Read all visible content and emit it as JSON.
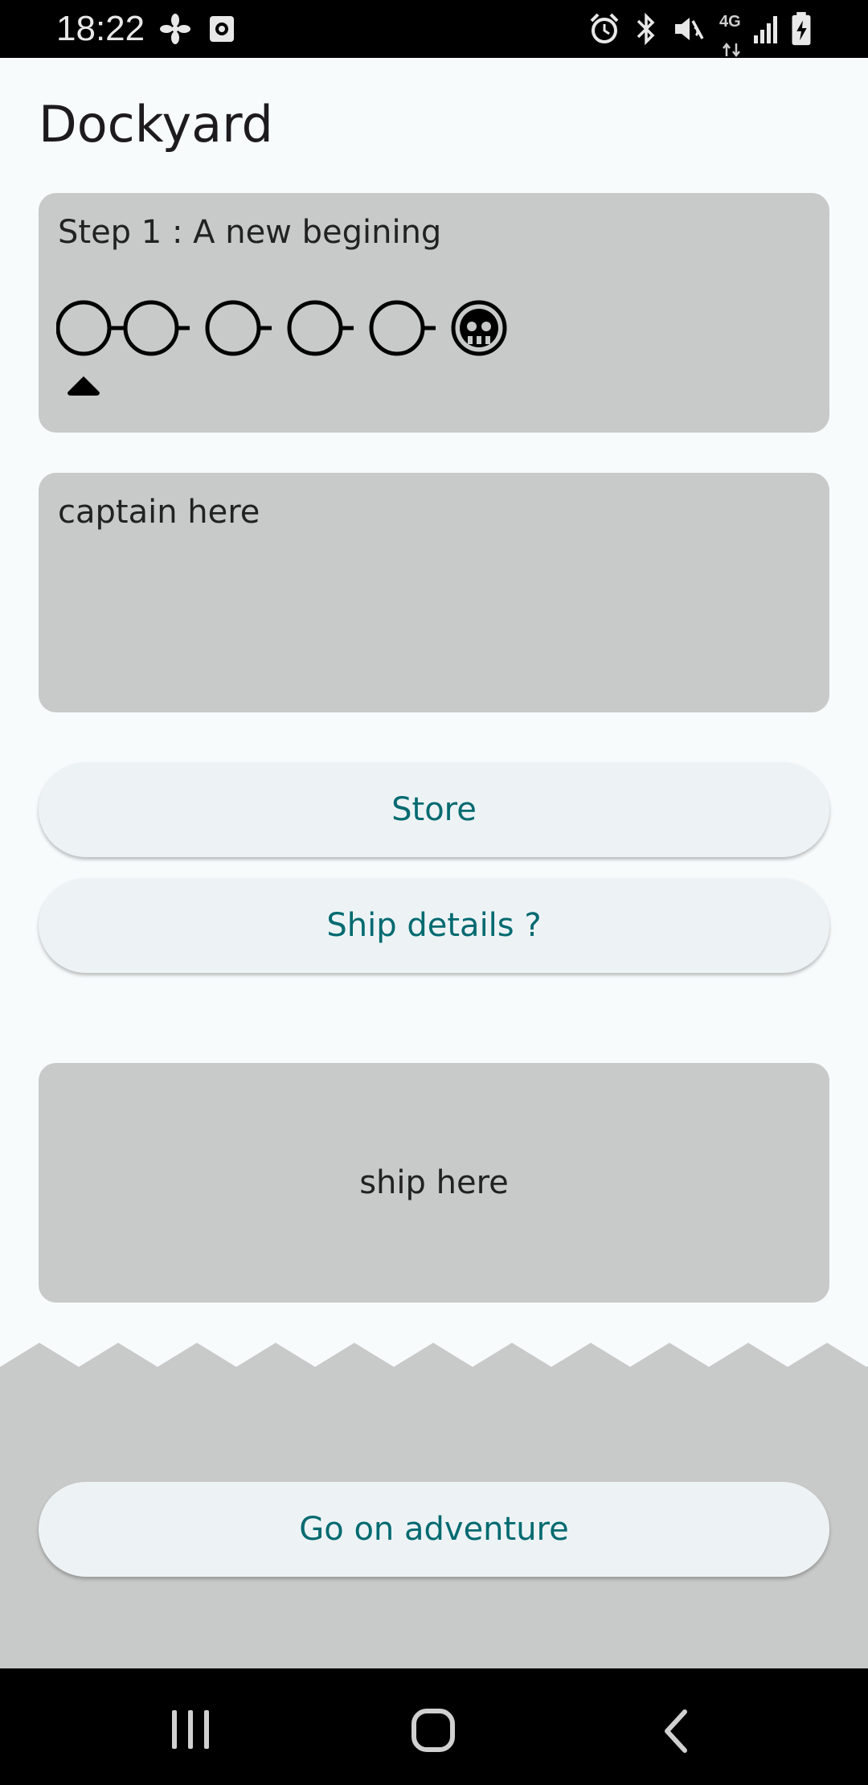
{
  "status_bar": {
    "time": "18:22",
    "network_type": "4G",
    "icons": [
      "fan-icon",
      "media-icon",
      "alarm-icon",
      "bluetooth-icon",
      "mute-icon",
      "signal-icon",
      "battery-icon"
    ]
  },
  "page": {
    "title": "Dockyard"
  },
  "step_card": {
    "label": "Step 1 : A new begining",
    "steps_total": 6,
    "current_step": 1,
    "final_step_icon": "skull-icon"
  },
  "captain_card": {
    "label": "captain here"
  },
  "buttons": {
    "store": "Store",
    "ship_details": "Ship details ?",
    "adventure": "Go on adventure"
  },
  "ship_card": {
    "label": "ship here"
  },
  "colors": {
    "accent": "#006a70",
    "card": "#c8c9c9",
    "background": "#f7fbfc",
    "button": "#edf3f5"
  }
}
